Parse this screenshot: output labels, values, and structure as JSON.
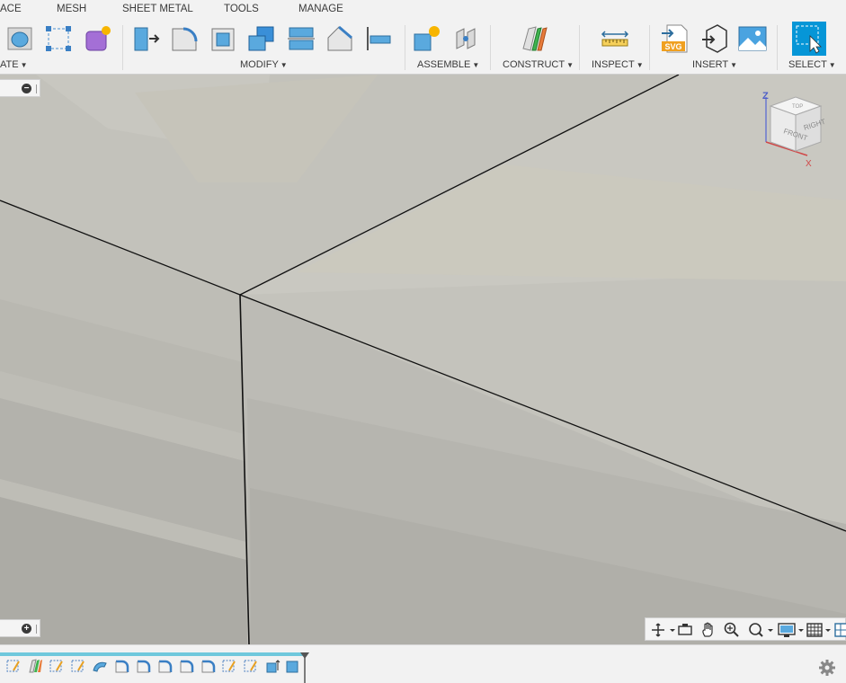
{
  "tabs": [
    "ACE",
    "MESH",
    "SHEET METAL",
    "TOOLS",
    "MANAGE"
  ],
  "groups": {
    "create": "ATE",
    "modify": "MODIFY",
    "assemble": "ASSEMBLE",
    "construct": "CONSTRUCT",
    "inspect": "INSPECT",
    "insert": "INSERT",
    "select": "SELECT"
  },
  "viewcube": {
    "top": "TOP",
    "front": "FRONT",
    "right": "RIGHT",
    "axis_z": "Z",
    "axis_x": "X"
  },
  "browser": {
    "top_button": "−",
    "bottom_button": "+"
  },
  "icons": {
    "insert_svg_badge": "SVG"
  },
  "colors": {
    "accent": "#0696d7",
    "timeline": "#6fc8dc",
    "viewport_bg": "#c2c1ba"
  }
}
